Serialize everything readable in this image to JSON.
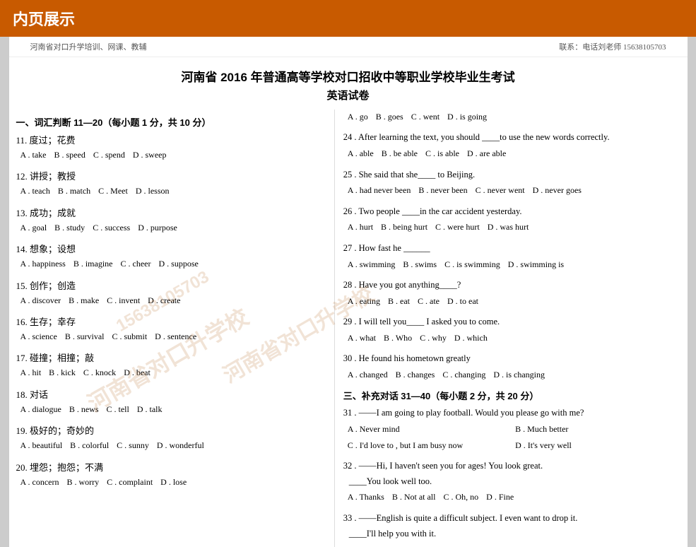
{
  "header": {
    "banner_title": "内页展示",
    "top_left": "河南省对口升学培训、网课、教辅",
    "top_right": "联系：电话刘老师 15638105703"
  },
  "exam": {
    "title": "河南省 2016 年普通高等学校对口招收中等职业学校毕业生考试",
    "subtitle": "英语试卷"
  },
  "left_section": {
    "section1_title": "一、词汇判断 11—20（每小题 1 分，共 10 分）",
    "questions": [
      {
        "num": "11",
        "chinese": "度过；花费",
        "options": [
          "A . take",
          "B . speed",
          "C . spend",
          "D . sweep"
        ]
      },
      {
        "num": "12",
        "chinese": "讲授；教授",
        "options": [
          "A . teach",
          "B . match",
          "C . Meet",
          "D . lesson"
        ]
      },
      {
        "num": "13",
        "chinese": "成功；成就",
        "options": [
          "A . goal",
          "B . study",
          "C . success",
          "D . purpose"
        ]
      },
      {
        "num": "14",
        "chinese": "想象；设想",
        "options": [
          "A . happiness",
          "B . imagine",
          "C . cheer",
          "D . suppose"
        ]
      },
      {
        "num": "15",
        "chinese": "创作；创造",
        "options": [
          "A . discover",
          "B . make",
          "C . invent",
          "D . create"
        ]
      },
      {
        "num": "16",
        "chinese": "生存；幸存",
        "options": [
          "A . science",
          "B . survival",
          "C . submit",
          "D . sentence"
        ]
      },
      {
        "num": "17",
        "chinese": "碰撞；相撞；敲",
        "options": [
          "A . hit",
          "B . kick",
          "C . knock",
          "D . beat"
        ]
      },
      {
        "num": "18",
        "chinese": "对话",
        "options": [
          "A . dialogue",
          "B . news",
          "C . tell",
          "D . talk"
        ]
      },
      {
        "num": "19",
        "chinese": "极好的；奇妙的",
        "options": [
          "A . beautiful",
          "B . colorful",
          "C . sunny",
          "D . wonderful"
        ]
      },
      {
        "num": "20",
        "chinese": "埋怨；抱怨；不满",
        "options": [
          "A . concern",
          "B . worry",
          "C . complaint",
          "D . lose"
        ]
      }
    ]
  },
  "right_section": {
    "q23_options": [
      "A . go",
      "B . goes",
      "C . went",
      "D . is going"
    ],
    "q24": {
      "stem": "24 . After learning the text, you should ____to use the new words correctly.",
      "options": [
        "A . able",
        "B . be able",
        "C . is able",
        "D . are able"
      ]
    },
    "q25": {
      "stem": "25 . She said that she____ to Beijing.",
      "options": [
        "A . had never been",
        "B . never been",
        "C . never went",
        "D . never goes"
      ]
    },
    "q26": {
      "stem": "26 . Two people ____in the car accident yesterday.",
      "options": [
        "A . hurt",
        "B . being hurt",
        "C . were hurt",
        "D . was hurt"
      ]
    },
    "q27": {
      "stem": "27 . How fast he ______",
      "options": [
        "A . swimming",
        "B . swims",
        "C . is swimming",
        "D . swimming is"
      ]
    },
    "q28": {
      "stem": "28 . Have you got anything____?",
      "options": [
        "A . eating",
        "B . eat",
        "C . ate",
        "D . to eat"
      ]
    },
    "q29": {
      "stem": "29 . I will tell you____ I asked you to come.",
      "options": [
        "A . what",
        "B . Who",
        "C . why",
        "D . which"
      ]
    },
    "q30": {
      "stem": "30 . He found his hometown greatly",
      "options": [
        "A . changed",
        "B . changes",
        "C . changing",
        "D . is changing"
      ]
    },
    "section3_title": "三、补充对话 31—40（每小题 2 分，共 20 分）",
    "q31": {
      "stem": "31 . ——I am going to play football. Would you please go with me?",
      "options": [
        "A . Never mind",
        "B . Much better",
        "C . I'd love to , but I am busy now",
        "D . It's very well"
      ]
    },
    "q32": {
      "stem": "32 . ——Hi, I haven't seen you for ages! You look great.",
      "stem2": "____You look well too.",
      "options": [
        "A . Thanks",
        "B . Not at all",
        "C . Oh, no",
        "D . Fine"
      ]
    },
    "q33": {
      "stem": "33 . ——English is quite a difficult subject. I even want to drop it.",
      "stem2": "____I'll help you with it."
    }
  },
  "watermark": {
    "text1": "河南省对口升学校",
    "text2": "15638105703",
    "text3": "河南省对口升学校"
  }
}
